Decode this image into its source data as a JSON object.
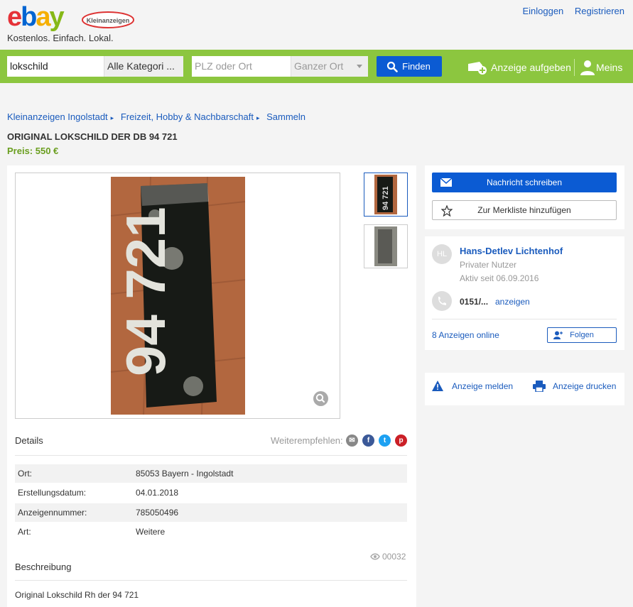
{
  "header": {
    "logo_text": "ebay",
    "logo_badge": "Kleinanzeigen",
    "tagline": "Kostenlos. Einfach. Lokal.",
    "login": "Einloggen",
    "register": "Registrieren"
  },
  "search": {
    "query": "lokschild",
    "category": "Alle Kategori ...",
    "location_placeholder": "PLZ oder Ort",
    "radius": "Ganzer Ort",
    "find_label": "Finden",
    "post_ad": "Anzeige aufgeben",
    "my_account": "Meins"
  },
  "breadcrumb": [
    "Kleinanzeigen Ingolstadt",
    "Freizeit, Hobby & Nachbarschaft",
    "Sammeln"
  ],
  "ad": {
    "title": "ORIGINAL LOKSCHILD DER DB 94 721",
    "price": "Preis: 550 €",
    "plate_text": "94 721",
    "details_heading": "Details",
    "share_label": "Weiterempfehlen:",
    "details": [
      {
        "key": "Ort:",
        "value": "85053 Bayern - Ingolstadt"
      },
      {
        "key": "Erstellungsdatum:",
        "value": "04.01.2018"
      },
      {
        "key": "Anzeigennummer:",
        "value": "785050496"
      },
      {
        "key": "Art:",
        "value": "Weitere"
      }
    ],
    "views": "00032",
    "description_heading": "Beschreibung",
    "description": "Original Lokschild Rh der 94 721"
  },
  "contact": {
    "message_button": "Nachricht schreiben",
    "watchlist_button": "Zur Merkliste hinzufügen",
    "avatar_initials": "HL",
    "name": "Hans-Detlev Lichtenhof",
    "type": "Privater Nutzer",
    "active_since": "Aktiv seit 06.09.2016",
    "phone": "0151/...",
    "show_phone": "anzeigen",
    "ads_online": "8 Anzeigen online",
    "follow": "Folgen"
  },
  "actions": {
    "report": "Anzeige melden",
    "print": "Anzeige drucken"
  },
  "colors": {
    "search_bar": "#8cc63f",
    "primary": "#0b5bd3",
    "link": "#1a5bbd",
    "price": "#6a9e1f"
  }
}
